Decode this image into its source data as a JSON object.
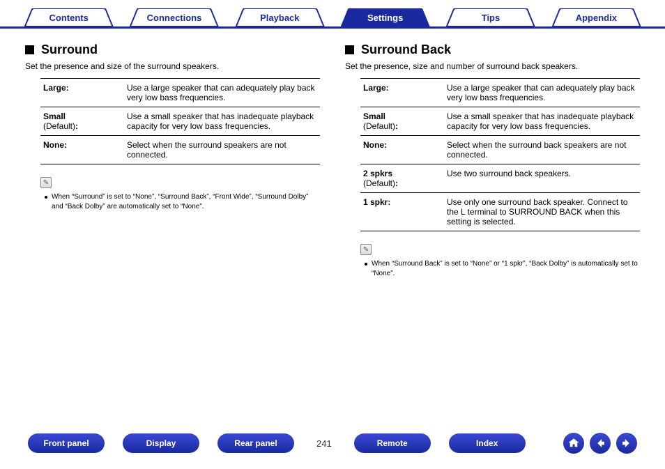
{
  "tabs": {
    "t0": "Contents",
    "t1": "Connections",
    "t2": "Playback",
    "t3": "Settings",
    "t4": "Tips",
    "t5": "Appendix"
  },
  "left": {
    "title": "Surround",
    "desc": "Set the presence and size of the surround speakers.",
    "rows": {
      "r0k": "Large:",
      "r0v": "Use a large speaker that can adequately play back very low bass frequencies.",
      "r1k": "Small",
      "r1d": " (Default)",
      "r1c": ":",
      "r1v": "Use a small speaker that has inadequate playback capacity for very low bass frequencies.",
      "r2k": "None:",
      "r2v": "Select when the surround speakers are not connected."
    },
    "note": "When “Surround” is set to “None”, “Surround Back”, “Front Wide”, “Surround Dolby” and “Back Dolby” are automatically set to “None”."
  },
  "right": {
    "title": "Surround Back",
    "desc": "Set the presence, size and number of surround back speakers.",
    "rows": {
      "r0k": "Large:",
      "r0v": "Use a large speaker that can adequately play back very low bass frequencies.",
      "r1k": "Small",
      "r1d": " (Default)",
      "r1c": ":",
      "r1v": "Use a small speaker that has inadequate playback capacity for very low bass frequencies.",
      "r2k": "None:",
      "r2v": "Select when the surround back speakers are not connected.",
      "r3k": "2 spkrs",
      "r3d": " (Default)",
      "r3c": ":",
      "r3v": "Use two surround back speakers.",
      "r4k": "1 spkr:",
      "r4v": "Use only one surround back speaker. Connect to the L terminal to SURROUND BACK when this setting is selected."
    },
    "note": "When “Surround Back” is set to “None” or “1 spkr”, “Back Dolby” is automatically set to “None”."
  },
  "footer": {
    "b0": "Front panel",
    "b1": "Display",
    "b2": "Rear panel",
    "page": "241",
    "b3": "Remote",
    "b4": "Index"
  }
}
